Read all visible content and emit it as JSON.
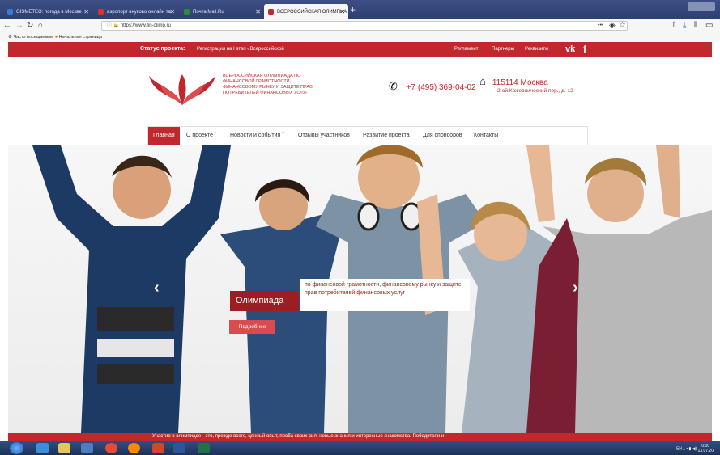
{
  "browser": {
    "tabs": [
      {
        "label": "GISMETEO: погода в Москве",
        "color": "#3a7bd5"
      },
      {
        "label": "аэропорт внуково онлайн та",
        "color": "#d9332b"
      },
      {
        "label": "Почта Mail.Ru",
        "color": "#2b8a3e"
      },
      {
        "label": "ВСЕРОССИЙСКАЯ ОЛИМПИА",
        "color": "#c1272d"
      }
    ],
    "new_tab": "+",
    "url": "https://www.fin-olimp.ru",
    "bookmarks": [
      "Часто посещаемые",
      "Начальная страница"
    ]
  },
  "topbar": {
    "status_label": "Статус проекта:",
    "status_value": "Регистрация на I этап «Всероссийской",
    "links": [
      "Регламент",
      "Партнеры",
      "Реквизиты"
    ],
    "social": [
      "vk-icon",
      "facebook-icon"
    ]
  },
  "header": {
    "logo_text": "ВСЕРОССИЙСКАЯ ОЛИМПИАДА ПО ФИНАНСОВОЙ ГРАМОТНОСТИ, ФИНАНСОВОМУ РЫНКУ И ЗАЩИТЕ ПРАВ ПОТРЕБИТЕЛЕЙ ФИНАНСОВЫХ УСЛУГ",
    "phone": "+7 (495) 369-04-02",
    "city": "115114 Москва",
    "street": "2-ой Кожевнический пер., д. 12"
  },
  "menu": [
    "Главная",
    "О проекте",
    "Новости и события",
    "Отзывы участников",
    "Развитие проекта",
    "Для спонсоров",
    "Контакты"
  ],
  "hero": {
    "title": "Олимпиада",
    "description": "по финансовой грамотности, финансовому рынку и защите прав потребителей финансовых услуг",
    "button": "Подробнее"
  },
  "footer_strip": "Участие в олимпиаде - это, прежде всего, ценный опыт, проба своих сил, новые знания и интересные знакомства. Победители и",
  "taskbar": {
    "lang": "EN",
    "time": "0:00",
    "date": "13.07.20"
  },
  "colors": {
    "brand": "#c1272d",
    "dark": "#9e1d22"
  }
}
